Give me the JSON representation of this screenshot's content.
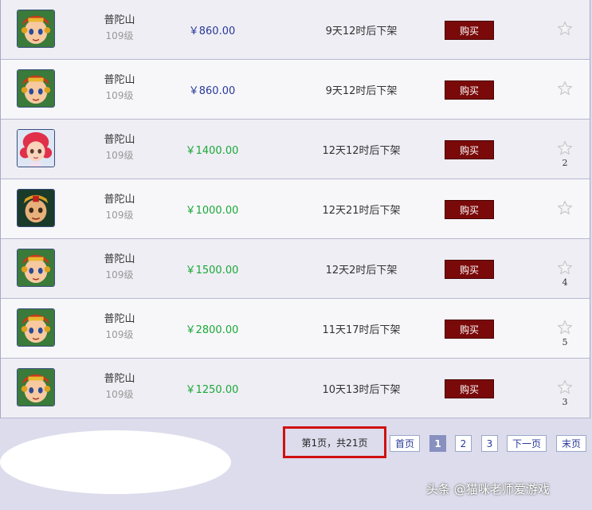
{
  "listings": [
    {
      "avatar": "char-a",
      "school": "普陀山",
      "level": "109级",
      "price": "￥860.00",
      "price_color": "blue",
      "time": "9天12时后下架",
      "buy": "购买",
      "fav": ""
    },
    {
      "avatar": "char-a",
      "school": "普陀山",
      "level": "109级",
      "price": "￥860.00",
      "price_color": "blue",
      "time": "9天12时后下架",
      "buy": "购买",
      "fav": ""
    },
    {
      "avatar": "char-b",
      "school": "普陀山",
      "level": "109级",
      "price": "￥1400.00",
      "price_color": "green",
      "time": "12天12时后下架",
      "buy": "购买",
      "fav": "2"
    },
    {
      "avatar": "char-c",
      "school": "普陀山",
      "level": "109级",
      "price": "￥1000.00",
      "price_color": "green",
      "time": "12天21时后下架",
      "buy": "购买",
      "fav": ""
    },
    {
      "avatar": "char-a",
      "school": "普陀山",
      "level": "109级",
      "price": "￥1500.00",
      "price_color": "green",
      "time": "12天2时后下架",
      "buy": "购买",
      "fav": "4"
    },
    {
      "avatar": "char-a",
      "school": "普陀山",
      "level": "109级",
      "price": "￥2800.00",
      "price_color": "green",
      "time": "11天17时后下架",
      "buy": "购买",
      "fav": "5"
    },
    {
      "avatar": "char-a",
      "school": "普陀山",
      "level": "109级",
      "price": "￥1250.00",
      "price_color": "green",
      "time": "10天13时后下架",
      "buy": "购买",
      "fav": "3"
    }
  ],
  "pagination": {
    "info": "第1页，共21页",
    "first": "首页",
    "pages": [
      "1",
      "2",
      "3"
    ],
    "current": "1",
    "next": "下一页",
    "last": "末页"
  },
  "watermark": "头条 @猫咪老师爱游戏",
  "colors": {
    "buy_bg": "#7a0a0a",
    "price_blue": "#2a3a9a",
    "price_green": "#1ca838",
    "highlight": "#d01010"
  }
}
